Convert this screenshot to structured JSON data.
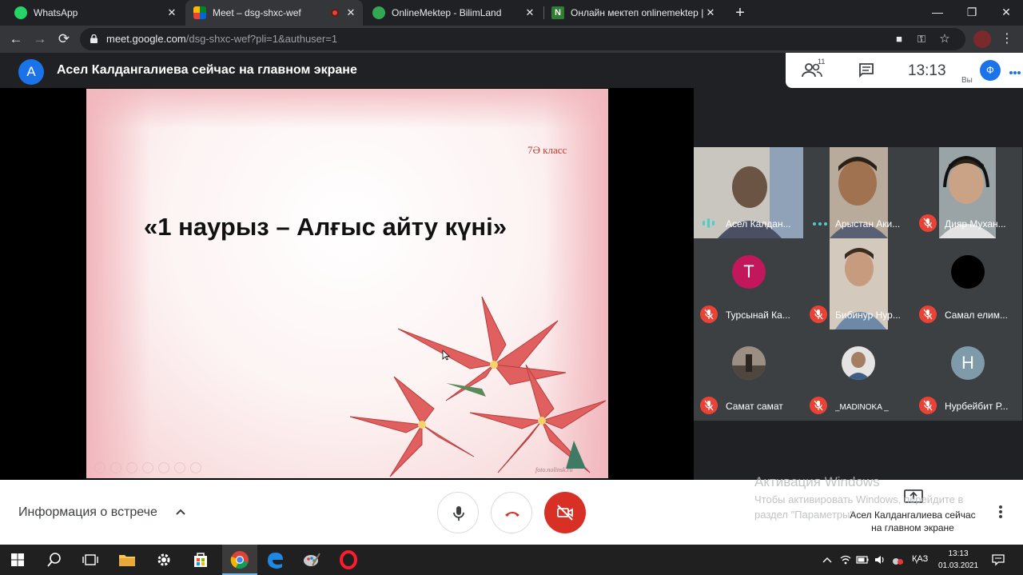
{
  "tabs": [
    {
      "title": "WhatsApp",
      "icon": "whatsapp-icon",
      "active": false
    },
    {
      "title": "Meet – dsg-shxc-wef",
      "icon": "meet-icon",
      "active": true,
      "recording": true
    },
    {
      "title": "OnlineMektep - BilimLand",
      "icon": "bilimland-icon",
      "active": false
    },
    {
      "title": "Онлайн мектеп onlinemektep |",
      "icon": "onlinemektep-icon",
      "active": false
    }
  ],
  "address_bar": {
    "domain": "meet.google.com",
    "path": "/dsg-shxc-wef?pli=1&authuser=1"
  },
  "meet_header": {
    "presenter_initial": "А",
    "presenting_title": "Асел Калдангалиева сейчас на главном экране",
    "participant_count": "11",
    "clock": "13:13",
    "self_label": "Вы",
    "self_initial": "Ф"
  },
  "slide": {
    "class_label": "7Ә класс",
    "title": "«1 наурыз – Алғыс айту күні»",
    "footer": "foto.nolinsk.ru"
  },
  "participants": [
    {
      "name": "Асел Калдан...",
      "type": "video",
      "status": "speaking"
    },
    {
      "name": "Арыстан Аки...",
      "type": "video",
      "status": "more"
    },
    {
      "name": "Дияр Мухан...",
      "type": "video",
      "status": "muted"
    },
    {
      "name": "Турсынай Ка...",
      "type": "avatar",
      "initial": "Т",
      "color": "#c2185b",
      "status": "muted"
    },
    {
      "name": "Бибинур Нур...",
      "type": "video",
      "status": "muted"
    },
    {
      "name": "Самал елим...",
      "type": "avatar",
      "initial": "",
      "color": "#000000",
      "status": "muted"
    },
    {
      "name": "Самат самат",
      "type": "photo",
      "status": "muted"
    },
    {
      "name": "_MADINOKA _",
      "type": "photo",
      "status": "muted"
    },
    {
      "name": "Нурбейбит Р...",
      "type": "avatar",
      "initial": "Н",
      "color": "#7f9aa8",
      "status": "muted"
    }
  ],
  "bottom_bar": {
    "meeting_info": "Информация о встрече",
    "present_label": "Асел Калдангалиева сейчас на главном экране"
  },
  "activation": {
    "title": "Активация Windows",
    "text": "Чтобы активировать Windows, перейдите в раздел \"Параметры\"."
  },
  "taskbar": {
    "language": "ҚАЗ",
    "time": "13:13",
    "date": "01.03.2021"
  },
  "colors": {
    "accent": "#1a73e8",
    "danger": "#ea4335",
    "meet_dark": "#202124"
  }
}
